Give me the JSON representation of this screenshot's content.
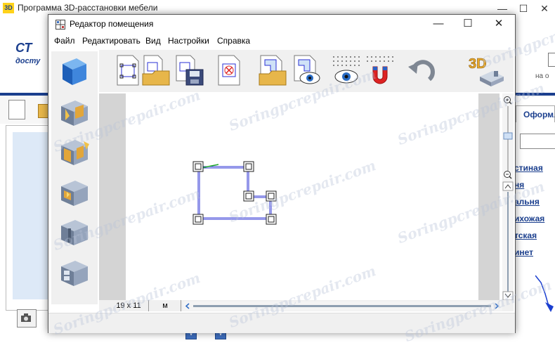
{
  "background_app": {
    "title_icon": "3D",
    "title": "Программа 3D-расстановки мебели",
    "logo": {
      "text": "СТ",
      "sub": "досту"
    },
    "right_hint": "на о",
    "right_tab": "Оформл",
    "room_links": [
      "стиная",
      "ня",
      "альня",
      "ихожая",
      "тская",
      "инет"
    ]
  },
  "dialog": {
    "title": "Редактор помещения",
    "menu": [
      "Файл",
      "Редактировать",
      "Вид",
      "Настройки",
      "Справка"
    ],
    "toolbar": [
      {
        "name": "new-room-tool"
      },
      {
        "name": "open-room-tool"
      },
      {
        "name": "save-room-tool"
      },
      {
        "name": "clear-room-tool"
      },
      {
        "name": "import-plan-tool"
      },
      {
        "name": "view-plan-tool"
      },
      {
        "name": "grid-view-tool"
      },
      {
        "name": "snap-magnet-tool"
      },
      {
        "name": "undo-tool"
      },
      {
        "name": "3d-view-tool",
        "label": "3D"
      }
    ],
    "sidebar_tools": [
      "wall-tool",
      "door-tool",
      "double-door-tool",
      "window-tool",
      "partition-tool",
      "niche-tool"
    ],
    "status": {
      "size": "19 x 11",
      "unit": "м"
    }
  },
  "watermark": "Soringpcrepair.com",
  "colors": {
    "accent_blue": "#1b3f8e",
    "wall_line": "#2b32d6",
    "canvas_gray": "#d4d4d4"
  }
}
